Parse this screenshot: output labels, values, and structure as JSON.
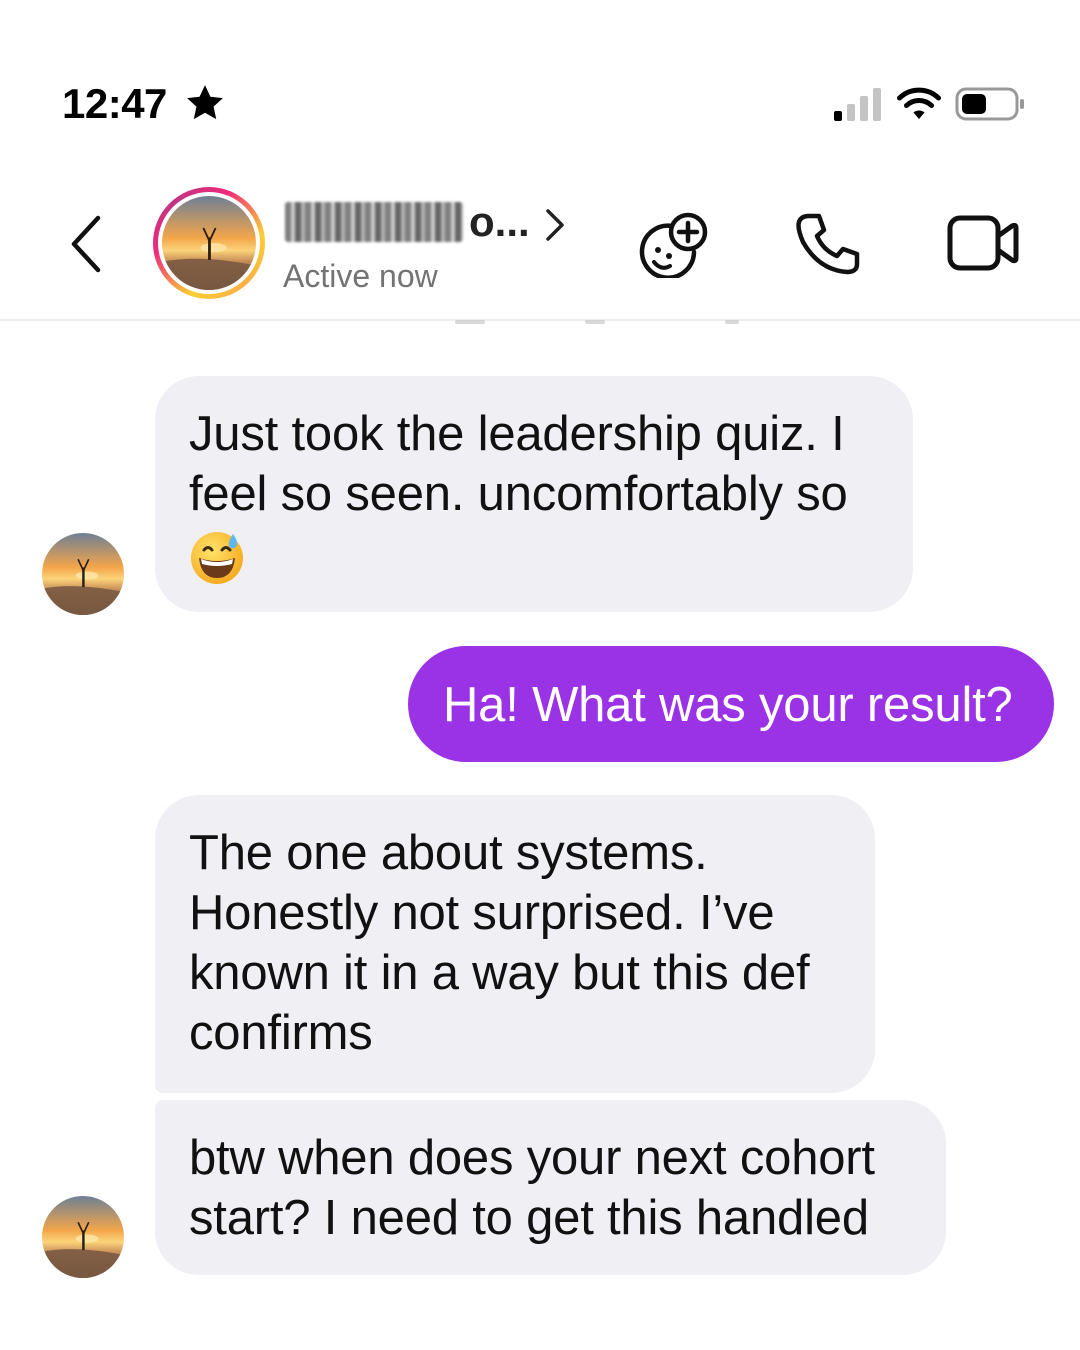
{
  "status_bar": {
    "time": "12:47",
    "star_icon": "star-icon",
    "signal_icon": "cellular-signal-icon",
    "wifi_icon": "wifi-icon",
    "battery_icon": "battery-icon"
  },
  "header": {
    "back_icon": "chevron-left-icon",
    "contact_name_visible": "o...",
    "contact_name_redacted": true,
    "active_status": "Active now",
    "actions": [
      {
        "name": "effects",
        "icon": "face-sticker-plus-icon"
      },
      {
        "name": "audio-call",
        "icon": "phone-icon"
      },
      {
        "name": "video-call",
        "icon": "video-camera-icon"
      }
    ],
    "ring_colors": [
      "#f9ce34",
      "#ee2a7b",
      "#c13584"
    ]
  },
  "messages": [
    {
      "direction": "incoming",
      "text": "Just took the leadership quiz. I feel so seen. uncomfortably so",
      "emoji": "grinning-face-with-sweat"
    },
    {
      "direction": "outgoing",
      "text": "Ha! What was your result?"
    },
    {
      "direction": "incoming",
      "text": "The one about systems. Honestly not surprised. I’ve known it in a way but this def confirms"
    },
    {
      "direction": "incoming",
      "text": "btw when does your next cohort start? I need to get this handled"
    }
  ],
  "colors": {
    "incoming_bubble": "#efeff4",
    "outgoing_bubble": "#9a33e6",
    "outgoing_text": "#ffffff",
    "secondary_text": "#737373"
  }
}
